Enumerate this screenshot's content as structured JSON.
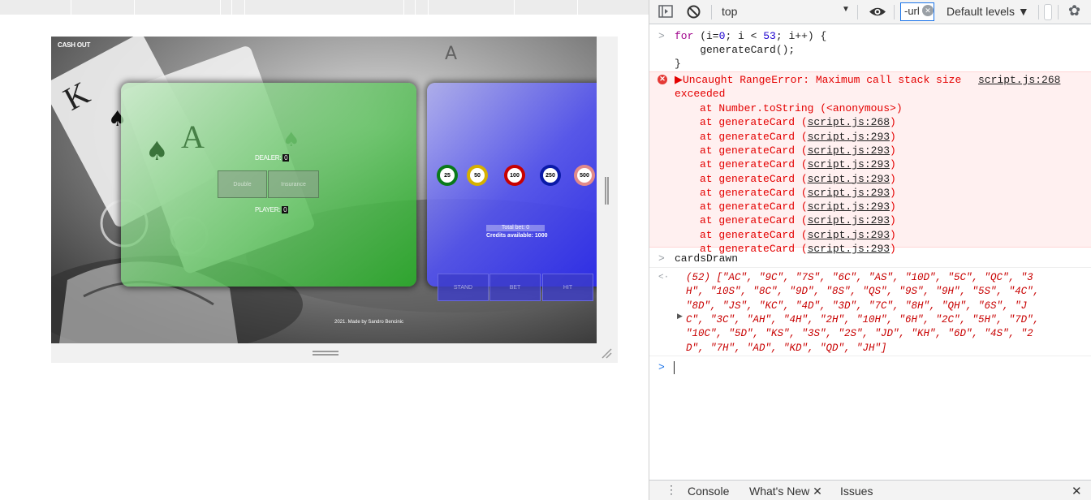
{
  "page": {
    "cash_out": "CASH OUT",
    "dealer_label": "DEALER:",
    "dealer_score": "0",
    "player_label": "PLAYER:",
    "player_score": "0",
    "double_label": "Double",
    "insurance_label": "Insurance",
    "chips": [
      {
        "value": "25",
        "ring": "#0a7a1a"
      },
      {
        "value": "50",
        "ring": "#d6b000"
      },
      {
        "value": "100",
        "ring": "#c80000"
      },
      {
        "value": "250",
        "ring": "#0a1aa8"
      },
      {
        "value": "500",
        "ring": "#e28a8a"
      }
    ],
    "total_bet": "Total bet: 0",
    "credits": "Credits available: 1000",
    "stand_label": "STAND",
    "bet_label": "BET",
    "hit_label": "HIT",
    "footer": "2021. Made by Sandro Bencinic"
  },
  "devtools": {
    "toolbar": {
      "context": "top",
      "filter_value": "-url",
      "levels": "Default levels ▼",
      "icons": [
        "sidebar-toggle-icon",
        "clear-console-icon",
        "eye-icon",
        "settings-gear-icon"
      ]
    },
    "input1": [
      "for (i=0; i < 53; i++) {",
      "    generateCard();",
      "}"
    ],
    "error": {
      "header": "▶Uncaught RangeError: Maximum call stack size",
      "header_cont": "exceeded",
      "source": "script.js:268",
      "frames": [
        {
          "fn": "at Number.toString (<anonymous>)",
          "loc": ""
        },
        {
          "fn": "at generateCard (",
          "loc": "script.js:268"
        },
        {
          "fn": "at generateCard (",
          "loc": "script.js:293"
        },
        {
          "fn": "at generateCard (",
          "loc": "script.js:293"
        },
        {
          "fn": "at generateCard (",
          "loc": "script.js:293"
        },
        {
          "fn": "at generateCard (",
          "loc": "script.js:293"
        },
        {
          "fn": "at generateCard (",
          "loc": "script.js:293"
        },
        {
          "fn": "at generateCard (",
          "loc": "script.js:293"
        },
        {
          "fn": "at generateCard (",
          "loc": "script.js:293"
        },
        {
          "fn": "at generateCard (",
          "loc": "script.js:293"
        },
        {
          "fn": "at generateCard (",
          "loc": "script.js:293"
        }
      ]
    },
    "input2": "cardsDrawn",
    "output_lines": [
      "(52) [\"AC\", \"9C\", \"7S\", \"6C\", \"AS\", \"10D\", \"5C\", \"QC\", \"3",
      "H\", \"10S\", \"8C\", \"9D\", \"8S\", \"QS\", \"9S\", \"9H\", \"5S\", \"4C\",",
      "\"8D\", \"JS\", \"KC\", \"4D\", \"3D\", \"7C\", \"8H\", \"QH\", \"6S\", \"J",
      "C\", \"3C\", \"AH\", \"4H\", \"2H\", \"10H\", \"6H\", \"2C\", \"5H\", \"7D\",",
      "\"10C\", \"5D\", \"KS\", \"3S\", \"2S\", \"JD\", \"KH\", \"6D\", \"4S\", \"2",
      "D\", \"7H\", \"AD\", \"KD\", \"QD\", \"JH\"]"
    ],
    "tabs": {
      "console": "Console",
      "whats_new": "What's New",
      "issues": "Issues"
    }
  }
}
